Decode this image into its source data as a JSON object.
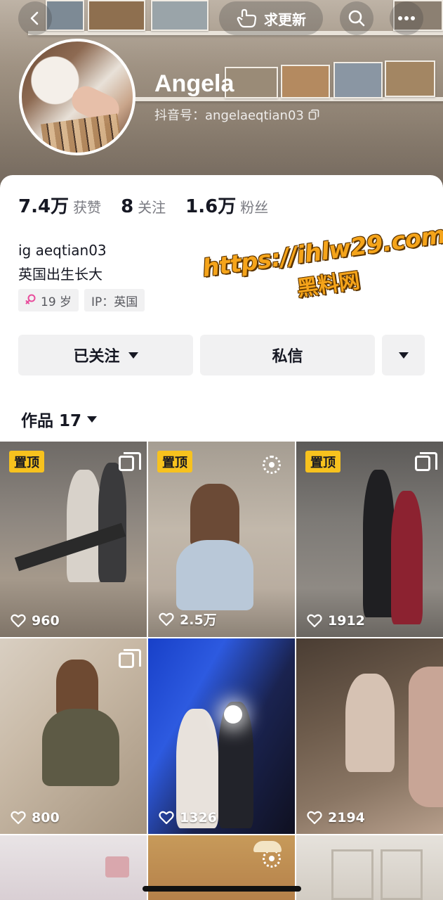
{
  "header": {
    "back_icon": "chevron-left-icon",
    "update_label": "求更新",
    "update_icon": "hand-pointing-icon",
    "search_icon": "search-icon",
    "more_icon": "more-dots-icon"
  },
  "profile": {
    "name": "Angela",
    "handle": "抖音号：angelaeqtian03",
    "copy_icon": "copy-icon"
  },
  "stats": {
    "likes_value": "7.4万",
    "likes_label": "获赞",
    "following_value": "8",
    "following_label": "关注",
    "followers_value": "1.6万",
    "followers_label": "粉丝"
  },
  "bio": {
    "line1": "ig aeqtian03",
    "line2": "英国出生长大"
  },
  "tags": {
    "age": "19 岁",
    "gender_icon": "female-icon",
    "ip": "IP：英国"
  },
  "actions": {
    "follow_label": "已关注",
    "message_label": "私信"
  },
  "works": {
    "label": "作品 17"
  },
  "watermark": {
    "url": "https://ihlw29.com",
    "text": "黑料网"
  },
  "posts": [
    {
      "pinned": "置顶",
      "likes": "960",
      "badge": "multi-image-icon"
    },
    {
      "pinned": "置顶",
      "likes": "2.5万",
      "badge": "live-photo-icon"
    },
    {
      "pinned": "置顶",
      "likes": "1912",
      "badge": "multi-image-icon"
    },
    {
      "pinned": "",
      "likes": "800",
      "badge": "multi-image-icon"
    },
    {
      "pinned": "",
      "likes": "1326",
      "badge": ""
    },
    {
      "pinned": "",
      "likes": "2194",
      "badge": ""
    }
  ],
  "colors": {
    "pin_bg": "#f7c21e",
    "watermark": "#f5a41a",
    "button_bg": "#f1f1f2"
  }
}
